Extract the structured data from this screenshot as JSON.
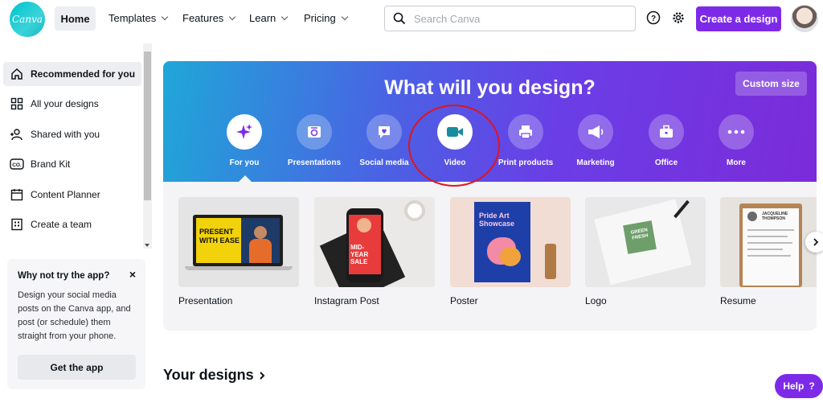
{
  "header": {
    "logo_text": "Canva",
    "home_label": "Home",
    "nav": [
      {
        "label": "Templates"
      },
      {
        "label": "Features"
      },
      {
        "label": "Learn"
      },
      {
        "label": "Pricing"
      }
    ],
    "search_placeholder": "Search Canva",
    "create_label": "Create a design"
  },
  "sidebar": {
    "items": [
      {
        "label": "Recommended for you",
        "icon": "home-icon",
        "active": true
      },
      {
        "label": "All your designs",
        "icon": "grid-icon"
      },
      {
        "label": "Shared with you",
        "icon": "shared-users-icon"
      },
      {
        "label": "Brand Kit",
        "icon": "brand-kit-icon"
      },
      {
        "label": "Content Planner",
        "icon": "calendar-icon"
      },
      {
        "label": "Create a team",
        "icon": "team-building-icon"
      }
    ],
    "promo": {
      "title": "Why not try the app?",
      "close": "×",
      "text": "Design your social media posts on the Canva app, and post (or schedule) them straight from your phone.",
      "button": "Get the app"
    }
  },
  "hero": {
    "title": "What will you design?",
    "custom_size": "Custom size",
    "categories": [
      {
        "label": "For you",
        "icon": "sparkle-icon",
        "selected": true
      },
      {
        "label": "Presentations",
        "icon": "presentation-icon"
      },
      {
        "label": "Social media",
        "icon": "heart-bubble-icon"
      },
      {
        "label": "Video",
        "icon": "video-camera-icon"
      },
      {
        "label": "Print products",
        "icon": "printer-icon"
      },
      {
        "label": "Marketing",
        "icon": "megaphone-icon"
      },
      {
        "label": "Office",
        "icon": "briefcase-icon"
      },
      {
        "label": "More",
        "icon": "more-dots-icon"
      }
    ]
  },
  "templates": [
    {
      "name": "Presentation",
      "thumb_text": "PRESENT WITH EASE"
    },
    {
      "name": "Instagram Post",
      "thumb_text": "MID-YEAR SALE"
    },
    {
      "name": "Poster",
      "thumb_text": "Pride Art Showcase"
    },
    {
      "name": "Logo",
      "thumb_text": "GREEN FRESH"
    },
    {
      "name": "Resume",
      "thumb_text": "JACQUELINE THOMPSON"
    }
  ],
  "your_designs": "Your designs",
  "help": {
    "label": "Help",
    "symbol": "?"
  },
  "colors": {
    "brand_purple": "#7d2ae8",
    "canva_teal": "#00c4cc",
    "annotation_red": "#e0141e"
  }
}
